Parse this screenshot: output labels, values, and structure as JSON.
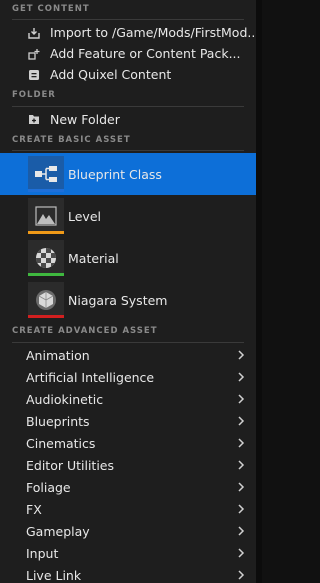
{
  "sections": {
    "get_content": "GET CONTENT",
    "folder": "FOLDER",
    "create_basic": "CREATE BASIC ASSET",
    "create_advanced": "CREATE ADVANCED ASSET"
  },
  "get_content_items": [
    {
      "label": "Import to /Game/Mods/FirstMod...",
      "icon": "import-icon"
    },
    {
      "label": "Add Feature or Content Pack...",
      "icon": "feature-pack-icon"
    },
    {
      "label": "Add Quixel Content",
      "icon": "quixel-icon"
    }
  ],
  "folder_items": [
    {
      "label": "New Folder",
      "icon": "new-folder-icon"
    }
  ],
  "basic_assets": [
    {
      "label": "Blueprint Class",
      "icon": "blueprint-class-icon",
      "bar_color": "#1e6fd9",
      "selected": true
    },
    {
      "label": "Level",
      "icon": "level-icon",
      "bar_color": "#f09a18",
      "selected": false
    },
    {
      "label": "Material",
      "icon": "material-icon",
      "bar_color": "#3fb83f",
      "selected": false
    },
    {
      "label": "Niagara System",
      "icon": "niagara-system-icon",
      "bar_color": "#d21f1f",
      "selected": false
    }
  ],
  "advanced_assets": [
    "Animation",
    "Artificial Intelligence",
    "Audiokinetic",
    "Blueprints",
    "Cinematics",
    "Editor Utilities",
    "Foliage",
    "FX",
    "Gameplay",
    "Input",
    "Live Link"
  ],
  "colors": {
    "selected": "#0d6fd8",
    "menu_bg": "#1e1e1e",
    "header_text": "#8a8a8a"
  }
}
